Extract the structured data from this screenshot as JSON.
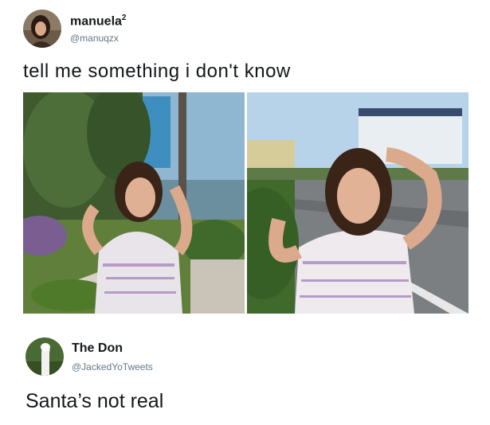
{
  "tweet1": {
    "display_name": "manuela",
    "name_superscript": "2",
    "handle": "@manuqzx",
    "text": "tell me something i don't know",
    "avatar_icon": "user-avatar-photo"
  },
  "media": {
    "photos": [
      "photo-girl-posing-garden",
      "photo-girl-posing-road"
    ]
  },
  "tweet2": {
    "display_name": "The Don",
    "handle": "@JackedYoTweets",
    "text": "Santa’s not real",
    "avatar_icon": "user-avatar-llama"
  },
  "colors": {
    "name": "#14171a",
    "handle": "#657786",
    "background": "#ffffff"
  }
}
